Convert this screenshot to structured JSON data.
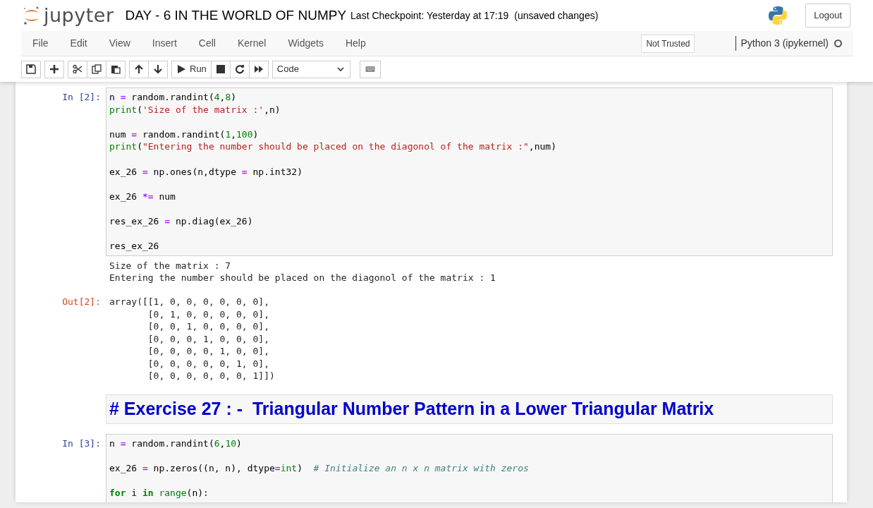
{
  "header": {
    "logo_text": "jupyter",
    "notebook_title": "DAY - 6 IN THE WORLD OF NUMPY",
    "checkpoint": "Last Checkpoint: Yesterday at 17:19",
    "autosave_status": "(unsaved changes)",
    "logout": "Logout"
  },
  "menu": [
    "File",
    "Edit",
    "View",
    "Insert",
    "Cell",
    "Kernel",
    "Widgets",
    "Help"
  ],
  "trust": "Not Trusted",
  "kernel": {
    "name": "Python 3 (ipykernel)",
    "busy": false
  },
  "toolbar": {
    "run": "Run",
    "cell_type": "Code"
  },
  "cells": [
    {
      "kind": "code",
      "prompt": "In [2]:",
      "lines": [
        {
          "tokens": [
            {
              "kind": "plain",
              "text": "n "
            },
            {
              "kind": "operator",
              "text": "="
            },
            {
              "kind": "plain",
              "text": " random.randint("
            },
            {
              "kind": "number",
              "text": "4"
            },
            {
              "kind": "plain",
              "text": ","
            },
            {
              "kind": "number",
              "text": "8"
            },
            {
              "kind": "plain",
              "text": ")"
            }
          ]
        },
        {
          "tokens": [
            {
              "kind": "builtin",
              "text": "print"
            },
            {
              "kind": "plain",
              "text": "("
            },
            {
              "kind": "string",
              "text": "'Size of the matrix :'"
            },
            {
              "kind": "plain",
              "text": ",n)"
            }
          ]
        },
        {
          "gap_before": true,
          "tokens": [
            {
              "kind": "plain",
              "text": "num "
            },
            {
              "kind": "operator",
              "text": "="
            },
            {
              "kind": "plain",
              "text": " random.randint("
            },
            {
              "kind": "number",
              "text": "1"
            },
            {
              "kind": "plain",
              "text": ","
            },
            {
              "kind": "number",
              "text": "100"
            },
            {
              "kind": "plain",
              "text": ")"
            }
          ]
        },
        {
          "tokens": [
            {
              "kind": "builtin",
              "text": "print"
            },
            {
              "kind": "plain",
              "text": "("
            },
            {
              "kind": "string",
              "text": "\"Entering the number should be placed on the diagonol of the matrix :\""
            },
            {
              "kind": "plain",
              "text": ",num)"
            }
          ]
        },
        {
          "gap_before": true,
          "tokens": [
            {
              "kind": "plain",
              "text": "ex_26 "
            },
            {
              "kind": "operator",
              "text": "="
            },
            {
              "kind": "plain",
              "text": " np.ones(n,dtype "
            },
            {
              "kind": "operator",
              "text": "="
            },
            {
              "kind": "plain",
              "text": " np.int32)"
            }
          ]
        },
        {
          "gap_before": true,
          "tokens": [
            {
              "kind": "plain",
              "text": "ex_26 "
            },
            {
              "kind": "operator",
              "text": "*="
            },
            {
              "kind": "plain",
              "text": " num"
            }
          ]
        },
        {
          "gap_before": true,
          "tokens": [
            {
              "kind": "plain",
              "text": "res_ex_26 "
            },
            {
              "kind": "operator",
              "text": "="
            },
            {
              "kind": "plain",
              "text": " np.diag(ex_26)"
            }
          ]
        },
        {
          "gap_before": true,
          "tokens": [
            {
              "kind": "plain",
              "text": "res_ex_26"
            }
          ]
        }
      ],
      "stdout": [
        "Size of the matrix : 7",
        "Entering the number should be placed on the diagonol of the matrix : 1"
      ],
      "out_prompt": "Out[2]:",
      "result": [
        "array([[1, 0, 0, 0, 0, 0, 0],",
        "       [0, 1, 0, 0, 0, 0, 0],",
        "       [0, 0, 1, 0, 0, 0, 0],",
        "       [0, 0, 0, 1, 0, 0, 0],",
        "       [0, 0, 0, 0, 1, 0, 0],",
        "       [0, 0, 0, 0, 0, 1, 0],",
        "       [0, 0, 0, 0, 0, 0, 1]])"
      ]
    },
    {
      "kind": "markdown",
      "text": "# Exercise 27 : -  Triangular Number Pattern in a Lower Triangular Matrix"
    },
    {
      "kind": "code",
      "prompt": "In [3]:",
      "lines": [
        {
          "tokens": [
            {
              "kind": "plain",
              "text": "n "
            },
            {
              "kind": "operator",
              "text": "="
            },
            {
              "kind": "plain",
              "text": " random.randint("
            },
            {
              "kind": "number",
              "text": "6"
            },
            {
              "kind": "plain",
              "text": ","
            },
            {
              "kind": "number",
              "text": "10"
            },
            {
              "kind": "plain",
              "text": ")"
            }
          ]
        },
        {
          "gap_before": true,
          "tokens": [
            {
              "kind": "plain",
              "text": "ex_26 "
            },
            {
              "kind": "operator",
              "text": "="
            },
            {
              "kind": "plain",
              "text": " np.zeros((n, n), dtype"
            },
            {
              "kind": "operator",
              "text": "="
            },
            {
              "kind": "builtin",
              "text": "int"
            },
            {
              "kind": "plain",
              "text": ")  "
            },
            {
              "kind": "comment",
              "text": "# Initialize an n x n matrix with zeros"
            }
          ]
        },
        {
          "gap_before": true,
          "tokens": [
            {
              "kind": "keyword",
              "text": "for"
            },
            {
              "kind": "plain",
              "text": " i "
            },
            {
              "kind": "keyword",
              "text": "in"
            },
            {
              "kind": "builtin",
              "text": " range"
            },
            {
              "kind": "plain",
              "text": "(n):"
            }
          ]
        }
      ]
    }
  ]
}
